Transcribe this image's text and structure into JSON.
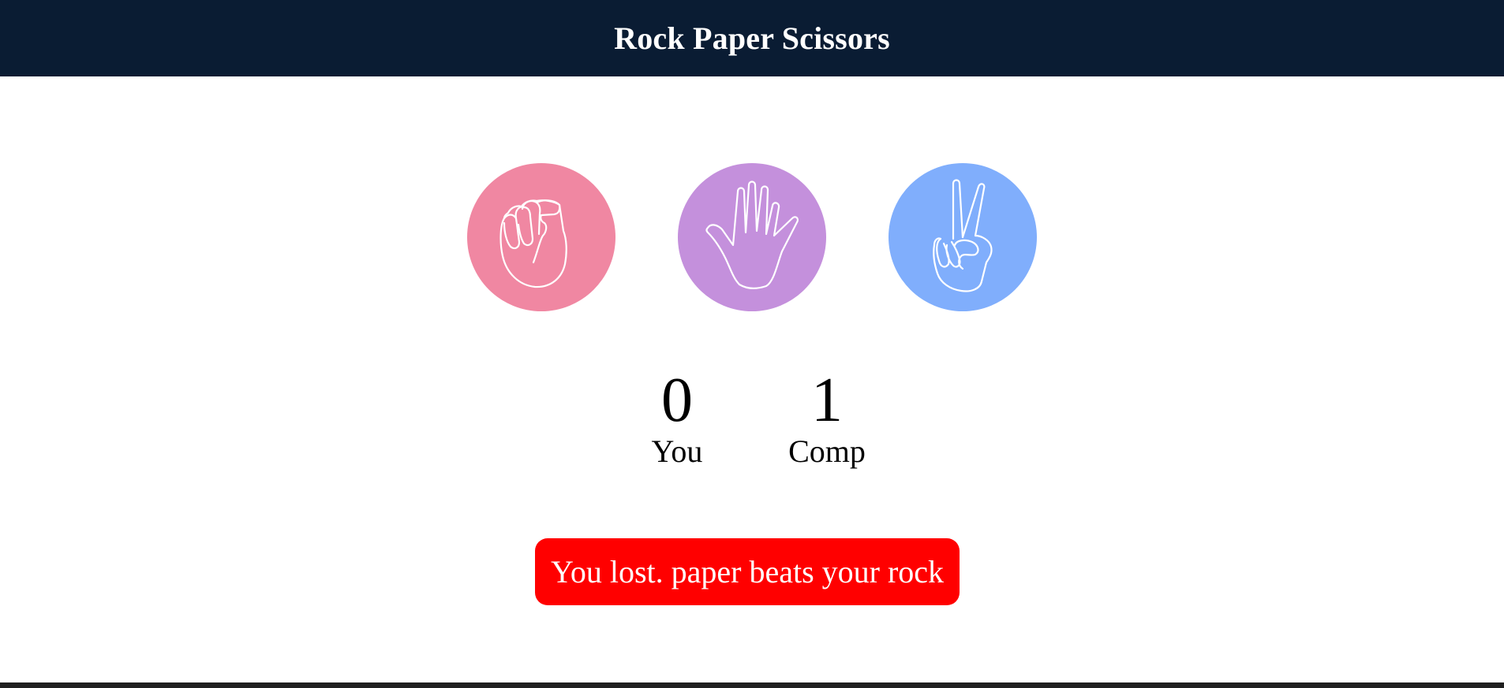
{
  "header": {
    "title": "Rock Paper Scissors",
    "background": "#0a1c33"
  },
  "choices": [
    {
      "name": "rock",
      "icon": "fist-icon",
      "color": "#f087a2"
    },
    {
      "name": "paper",
      "icon": "open-hand-icon",
      "color": "#c490dc"
    },
    {
      "name": "scissors",
      "icon": "peace-hand-icon",
      "color": "#80aefc"
    }
  ],
  "scoreboard": {
    "user_score": "0",
    "user_label": "You",
    "comp_score": "1",
    "comp_label": "Comp"
  },
  "result": {
    "message": "You lost. paper beats your rock",
    "color": "#ff0000"
  }
}
